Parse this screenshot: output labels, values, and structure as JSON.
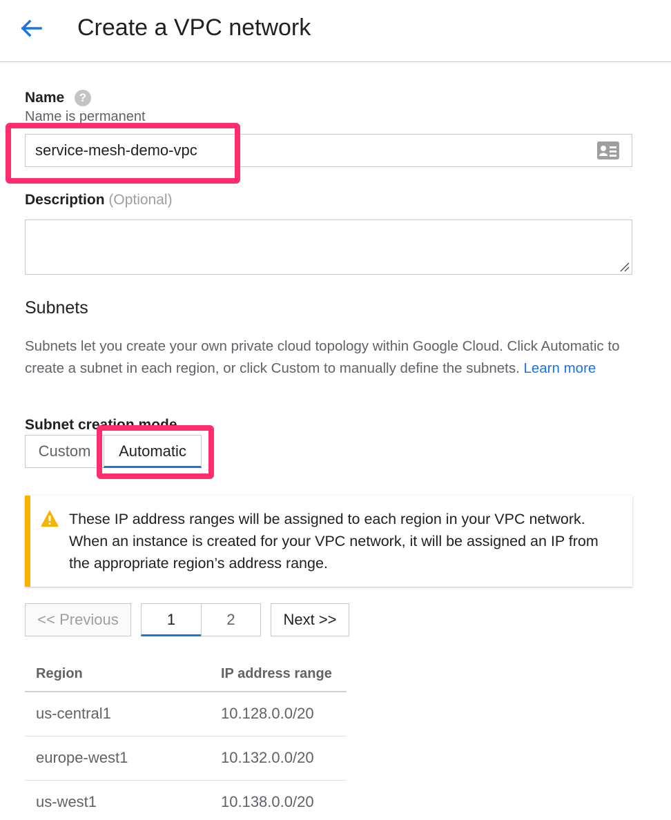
{
  "header": {
    "title": "Create a VPC network",
    "back_icon": "arrow-back-icon"
  },
  "name_field": {
    "label": "Name",
    "help_icon": "?",
    "sublabel": "Name is permanent",
    "value": "service-mesh-demo-vpc",
    "card_icon": "contact-card-icon"
  },
  "description_field": {
    "label": "Description",
    "optional": "(Optional)",
    "value": ""
  },
  "subnets": {
    "title": "Subnets",
    "help_text": "Subnets let you create your own private cloud topology within Google Cloud. Click Automatic to create a subnet in each region, or click Custom to manually define the subnets.",
    "learn_more": "Learn more",
    "mode_label": "Subnet creation mode",
    "mode_custom": "Custom",
    "mode_automatic": "Automatic",
    "selected_mode": "Automatic"
  },
  "warning": {
    "text": "These IP address ranges will be assigned to each region in your VPC network. When an instance is created for your VPC network, it will be assigned an IP from the appropriate region’s address range.",
    "icon": "warning-icon",
    "color": "#f5b400"
  },
  "pagination": {
    "previous": "<< Previous",
    "page1": "1",
    "page2": "2",
    "next": "Next >>",
    "current_page": 1
  },
  "region_table": {
    "headers": [
      "Region",
      "IP address range"
    ],
    "rows": [
      [
        "us-central1",
        "10.128.0.0/20"
      ],
      [
        "europe-west1",
        "10.132.0.0/20"
      ],
      [
        "us-west1",
        "10.138.0.0/20"
      ]
    ]
  },
  "colors": {
    "accent": "#1a73e8",
    "highlight": "#ff2d6e",
    "warning": "#f5b400"
  }
}
